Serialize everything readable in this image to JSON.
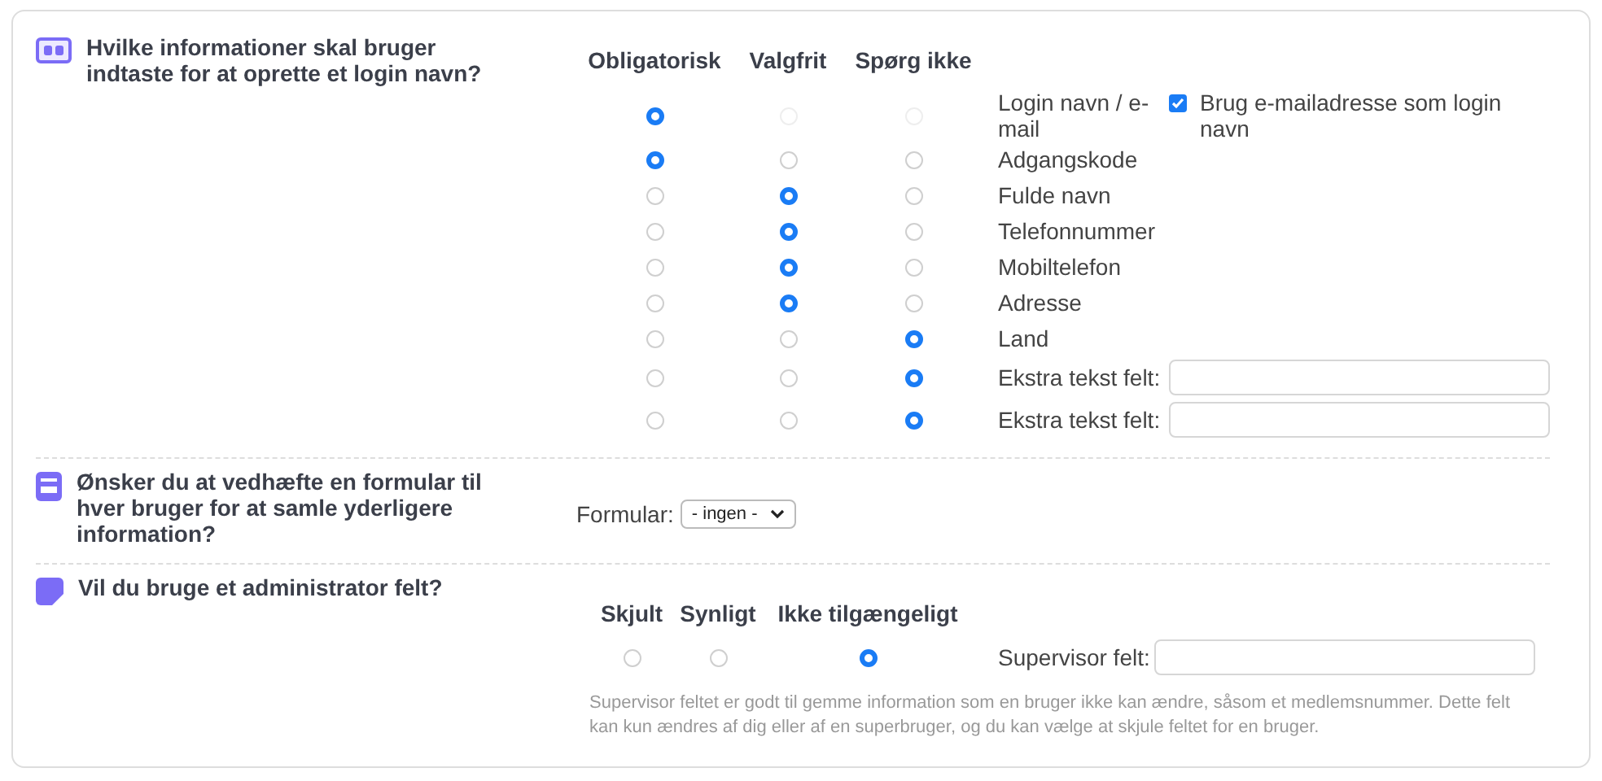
{
  "sections": [
    {
      "kind": "matrix",
      "title": "Hvilke informationer skal bruger indtaste for at oprette et login navn?",
      "columns": [
        "Obligatorisk",
        "Valgfrit",
        "Spørg ikke"
      ],
      "rows": [
        {
          "label": "Login navn / e-mail",
          "options": [
            {
              "selected": true,
              "disabled": false
            },
            {
              "selected": false,
              "disabled": true
            },
            {
              "selected": false,
              "disabled": true
            }
          ],
          "extra": {
            "kind": "checkbox",
            "label": "Brug e-mailadresse som login navn",
            "checked": true
          }
        },
        {
          "label": "Adgangskode",
          "options": [
            {
              "selected": true,
              "disabled": false
            },
            {
              "selected": false,
              "disabled": false
            },
            {
              "selected": false,
              "disabled": false
            }
          ]
        },
        {
          "label": "Fulde navn",
          "options": [
            {
              "selected": false,
              "disabled": false
            },
            {
              "selected": true,
              "disabled": false
            },
            {
              "selected": false,
              "disabled": false
            }
          ]
        },
        {
          "label": "Telefonnummer",
          "options": [
            {
              "selected": false,
              "disabled": false
            },
            {
              "selected": true,
              "disabled": false
            },
            {
              "selected": false,
              "disabled": false
            }
          ]
        },
        {
          "label": "Mobiltelefon",
          "options": [
            {
              "selected": false,
              "disabled": false
            },
            {
              "selected": true,
              "disabled": false
            },
            {
              "selected": false,
              "disabled": false
            }
          ]
        },
        {
          "label": "Adresse",
          "options": [
            {
              "selected": false,
              "disabled": false
            },
            {
              "selected": true,
              "disabled": false
            },
            {
              "selected": false,
              "disabled": false
            }
          ]
        },
        {
          "label": "Land",
          "options": [
            {
              "selected": false,
              "disabled": false
            },
            {
              "selected": false,
              "disabled": false
            },
            {
              "selected": true,
              "disabled": false
            }
          ]
        },
        {
          "label": "Ekstra tekst felt:",
          "options": [
            {
              "selected": false,
              "disabled": false
            },
            {
              "selected": false,
              "disabled": false
            },
            {
              "selected": true,
              "disabled": false
            }
          ],
          "extra": {
            "kind": "input"
          }
        },
        {
          "label": "Ekstra tekst felt:",
          "options": [
            {
              "selected": false,
              "disabled": false
            },
            {
              "selected": false,
              "disabled": false
            },
            {
              "selected": true,
              "disabled": false
            }
          ],
          "extra": {
            "kind": "input"
          }
        }
      ]
    },
    {
      "kind": "select",
      "title": "Ønsker du at vedhæfte en formular til hver bruger for at samle yderligere information?",
      "label": "Formular:",
      "value": "- ingen -"
    },
    {
      "kind": "choice",
      "title": "Vil du bruge et administrator felt?",
      "columns": [
        "Skjult",
        "Synligt",
        "Ikke tilgængeligt"
      ],
      "options": [
        {
          "selected": false
        },
        {
          "selected": false
        },
        {
          "selected": true
        }
      ],
      "field_label": "Supervisor felt:",
      "help": "Supervisor feltet er godt til gemme information som en bruger ikke kan ændre, såsom et medlemsnummer. Dette felt kan kun ændres af dig eller af en superbruger, og du kan vælge at skjule feltet for en bruger."
    }
  ]
}
